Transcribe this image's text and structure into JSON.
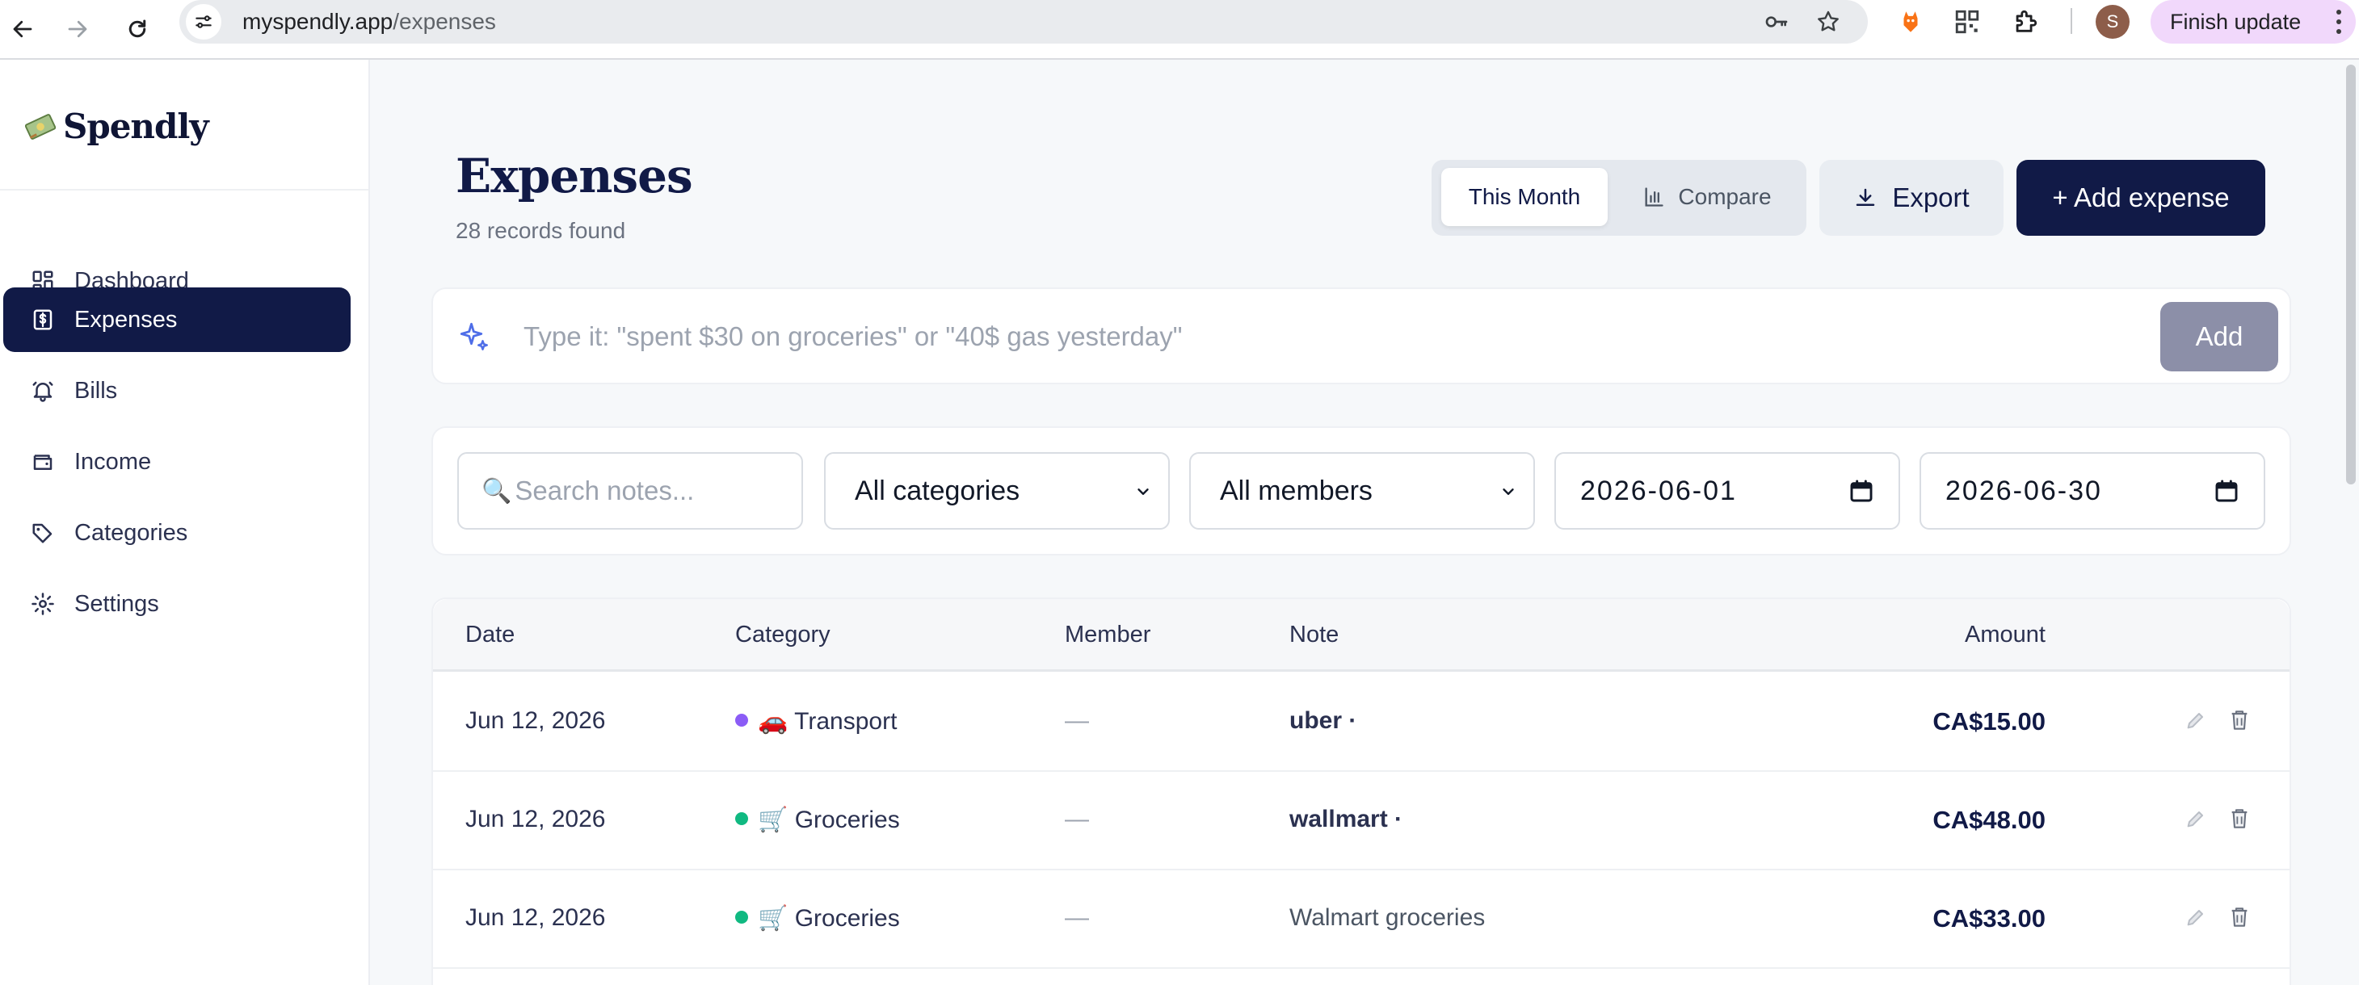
{
  "browser": {
    "url_host": "myspendly.app",
    "url_path": "/expenses",
    "profile_initial": "S",
    "finish_update_label": "Finish update"
  },
  "sidebar": {
    "brand": "Spendly",
    "items": [
      {
        "label": "Dashboard",
        "icon": "dashboard-icon",
        "active": false
      },
      {
        "label": "Expenses",
        "icon": "dollar-receipt-icon",
        "active": true
      },
      {
        "label": "Bills",
        "icon": "bell-icon",
        "active": false
      },
      {
        "label": "Income",
        "icon": "wallet-icon",
        "active": false
      },
      {
        "label": "Categories",
        "icon": "tag-icon",
        "active": false
      },
      {
        "label": "Settings",
        "icon": "gear-icon",
        "active": false
      }
    ]
  },
  "header": {
    "title": "Expenses",
    "records": "28 records found",
    "segment": {
      "this_month": "This Month",
      "compare": "Compare"
    },
    "export_label": "Export",
    "add_label": "+ Add expense"
  },
  "quick_add": {
    "placeholder": "Type it: \"spent $30 on groceries\" or \"40$ gas yesterday\"",
    "button": "Add"
  },
  "filters": {
    "search_placeholder": "Search notes...",
    "category": "All categories",
    "member": "All members",
    "date_from": "2026-06-01",
    "date_to": "2026-06-30"
  },
  "table": {
    "columns": {
      "date": "Date",
      "category": "Category",
      "member": "Member",
      "note": "Note",
      "amount": "Amount"
    },
    "rows": [
      {
        "date": "Jun 12, 2026",
        "category": "🚗 Transport",
        "dot_color": "#8b5cf6",
        "member": "—",
        "note": "uber ·",
        "note_bold": true,
        "amount": "CA$15.00"
      },
      {
        "date": "Jun 12, 2026",
        "category": "🛒 Groceries",
        "dot_color": "#10b981",
        "member": "—",
        "note": "wallmart ·",
        "note_bold": true,
        "amount": "CA$48.00"
      },
      {
        "date": "Jun 12, 2026",
        "category": "🛒 Groceries",
        "dot_color": "#10b981",
        "member": "—",
        "note": "Walmart groceries",
        "note_bold": false,
        "amount": "CA$33.00"
      }
    ]
  },
  "colors": {
    "brand_navy": "#111a47",
    "background": "#f6f8fa",
    "transport_dot": "#8b5cf6",
    "groceries_dot": "#10b981"
  }
}
